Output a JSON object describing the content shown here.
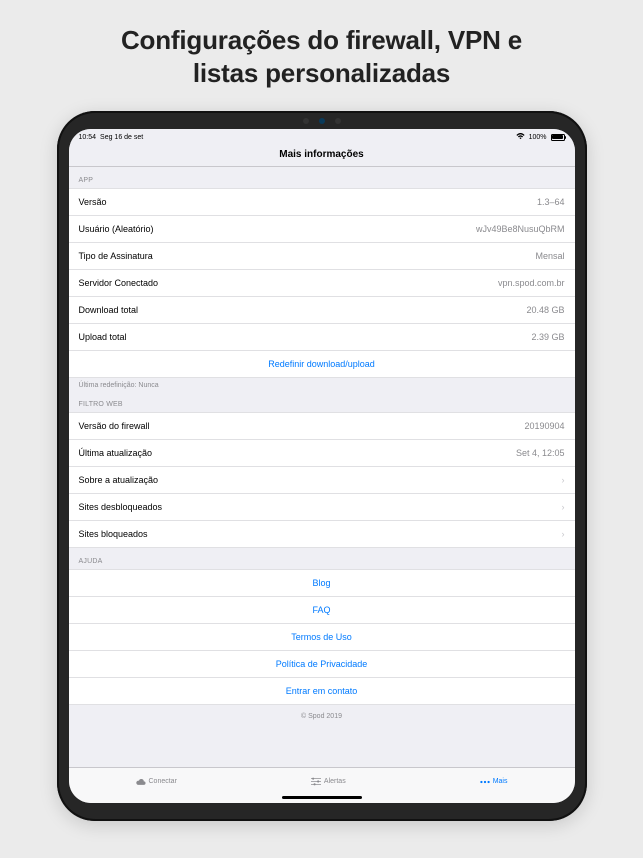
{
  "marketing": {
    "title_line1": "Configurações do firewall, VPN e",
    "title_line2": "listas personalizadas"
  },
  "status": {
    "time": "10:54",
    "date": "Seg 16 de set",
    "battery": "100%"
  },
  "nav": {
    "title": "Mais informações"
  },
  "sections": {
    "app": {
      "header": "APP",
      "rows": {
        "version": {
          "label": "Versão",
          "value": "1.3–64"
        },
        "user": {
          "label": "Usuário (Aleatório)",
          "value": "wJv49Be8NusuQbRM"
        },
        "subscription": {
          "label": "Tipo de Assinatura",
          "value": "Mensal"
        },
        "server": {
          "label": "Servidor Conectado",
          "value": "vpn.spod.com.br"
        },
        "download": {
          "label": "Download total",
          "value": "20.48 GB"
        },
        "upload": {
          "label": "Upload total",
          "value": "2.39 GB"
        }
      },
      "reset_link": "Redefinir download/upload",
      "footer": "Última redefinição: Nunca"
    },
    "webfilter": {
      "header": "FILTRO WEB",
      "rows": {
        "fw_version": {
          "label": "Versão do firewall",
          "value": "20190904"
        },
        "last_update": {
          "label": "Última atualização",
          "value": "Set 4, 12:05"
        },
        "about_update": {
          "label": "Sobre a atualização"
        },
        "unblocked": {
          "label": "Sites desbloqueados"
        },
        "blocked": {
          "label": "Sites bloqueados"
        }
      }
    },
    "help": {
      "header": "AJUDA",
      "links": {
        "blog": "Blog",
        "faq": "FAQ",
        "terms": "Termos de Uso",
        "privacy": "Política de Privacidade",
        "contact": "Entrar em contato"
      }
    }
  },
  "copyright": "© Spod 2019",
  "tabs": {
    "connect": "Conectar",
    "alerts": "Alertas",
    "more": "Mais"
  }
}
